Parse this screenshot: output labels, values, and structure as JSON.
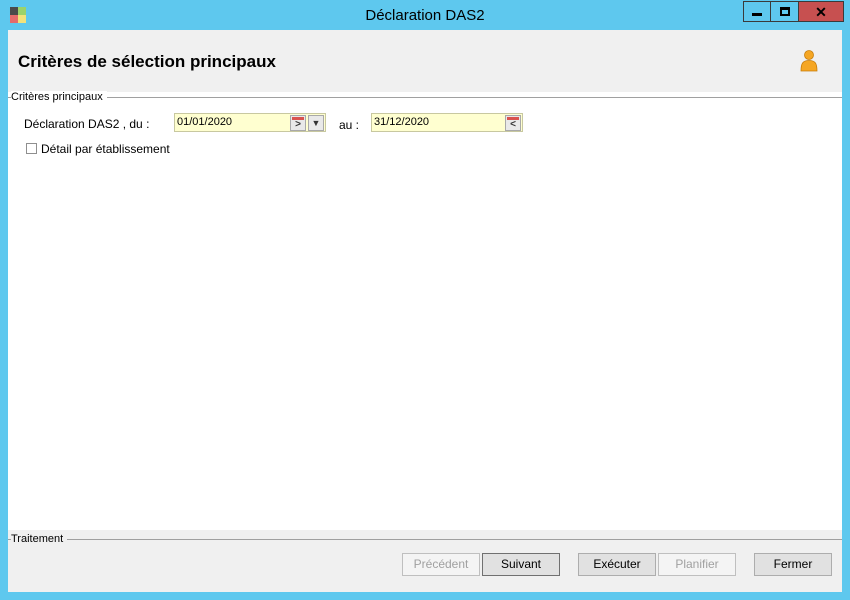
{
  "window": {
    "title": "Déclaration DAS2",
    "close_glyph": "✕"
  },
  "header": {
    "title": "Critères de sélection principaux"
  },
  "criteria": {
    "group_label": "Critères principaux",
    "from_label": "Déclaration DAS2 , du :",
    "from_value": "01/01/2020",
    "to_label": "au :",
    "to_value": "31/12/2020",
    "checkbox_label": "Détail par établissement",
    "checkbox_checked": false
  },
  "footer": {
    "group_label": "Traitement",
    "buttons": {
      "previous": "Précédent",
      "next": "Suivant",
      "execute": "Exécuter",
      "schedule": "Planifier",
      "close": "Fermer"
    }
  },
  "icons": {
    "app": "app-icon",
    "user": "user-icon",
    "calendar": "calendar-icon",
    "dropdown": "chevron-down-icon"
  },
  "colors": {
    "title_bar": "#5ec8ee",
    "close_button": "#c75050",
    "date_field": "#ffffd0",
    "user_icon": "#f5a623"
  }
}
